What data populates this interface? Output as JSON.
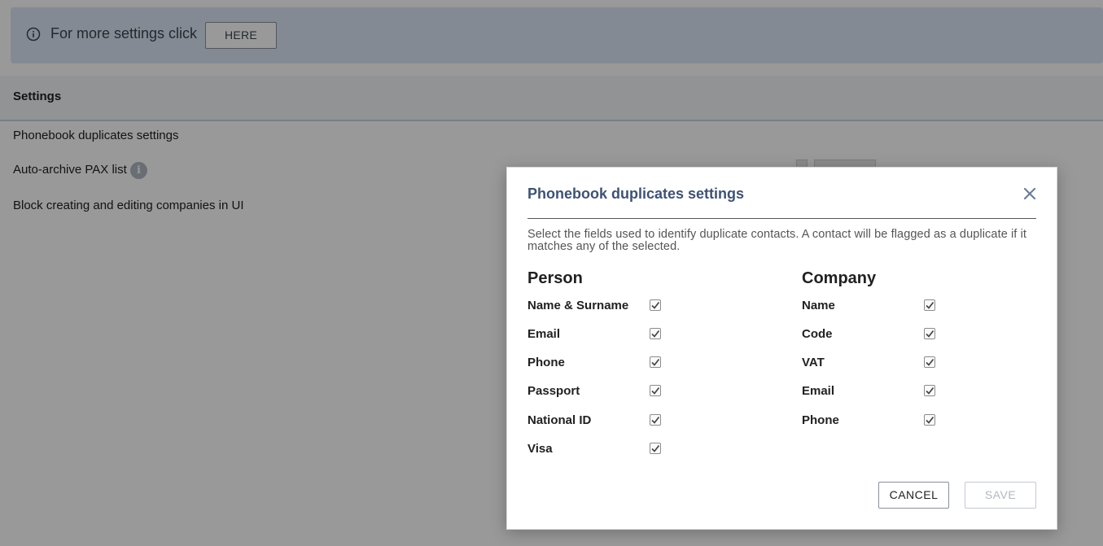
{
  "banner": {
    "text": "For more settings click",
    "button_label": "HERE"
  },
  "settings": {
    "title": "Settings",
    "rows": [
      {
        "label": "Phonebook duplicates settings"
      },
      {
        "label": "Auto-archive PAX list"
      },
      {
        "label": "Block creating and editing companies in UI"
      }
    ],
    "help_icon": "info-icon"
  },
  "modal": {
    "title": "Phonebook duplicates settings",
    "close_icon": "close-icon",
    "description": "Select the fields used to identify duplicate contacts. A contact will be flagged as a duplicate if it matches any of the selected.",
    "person": {
      "title": "Person",
      "fields": [
        {
          "label": "Name & Surname",
          "checked": true
        },
        {
          "label": "Email",
          "checked": true
        },
        {
          "label": "Phone",
          "checked": true
        },
        {
          "label": "Passport",
          "checked": true
        },
        {
          "label": "National ID",
          "checked": true
        },
        {
          "label": "Visa",
          "checked": true
        }
      ]
    },
    "company": {
      "title": "Company",
      "fields": [
        {
          "label": "Name",
          "checked": true
        },
        {
          "label": "Code",
          "checked": true
        },
        {
          "label": "VAT",
          "checked": true
        },
        {
          "label": "Email",
          "checked": true
        },
        {
          "label": "Phone",
          "checked": true
        }
      ]
    },
    "cancel_label": "CANCEL",
    "save_label": "SAVE"
  },
  "colors": {
    "modal_title": "#3f5273",
    "banner_bg": "#dce6f5",
    "save_disabled": "#b3b8bf"
  }
}
